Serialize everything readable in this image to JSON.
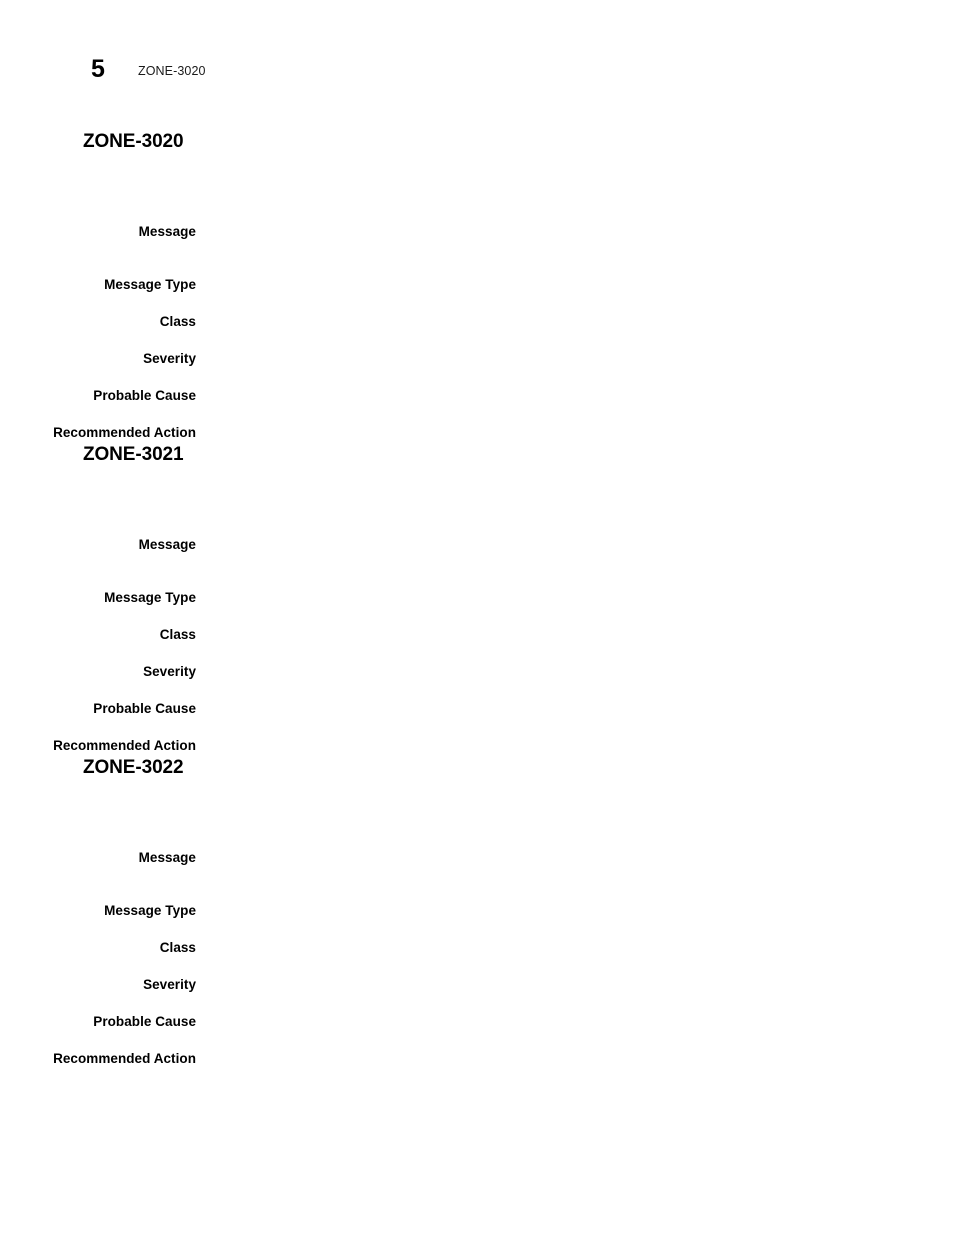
{
  "page": {
    "number": "5",
    "running_head": "ZONE-3020",
    "background_color": "#ffffff",
    "text_color": "#000000"
  },
  "field_labels": {
    "message": "Message",
    "message_type": "Message Type",
    "class": "Class",
    "severity": "Severity",
    "probable_cause": "Probable Cause",
    "recommended_action": "Recommended Action"
  },
  "sections": [
    {
      "heading": "ZONE-3020",
      "fields": [
        {
          "label": "Message",
          "value": ""
        },
        {
          "label": "Message Type",
          "value": ""
        },
        {
          "label": "Class",
          "value": ""
        },
        {
          "label": "Severity",
          "value": ""
        },
        {
          "label": "Probable Cause",
          "value": ""
        },
        {
          "label": "Recommended Action",
          "value": ""
        }
      ]
    },
    {
      "heading": "ZONE-3021",
      "fields": [
        {
          "label": "Message",
          "value": ""
        },
        {
          "label": "Message Type",
          "value": ""
        },
        {
          "label": "Class",
          "value": ""
        },
        {
          "label": "Severity",
          "value": ""
        },
        {
          "label": "Probable Cause",
          "value": ""
        },
        {
          "label": "Recommended Action",
          "value": ""
        }
      ]
    },
    {
      "heading": "ZONE-3022",
      "fields": [
        {
          "label": "Message",
          "value": ""
        },
        {
          "label": "Message Type",
          "value": ""
        },
        {
          "label": "Class",
          "value": ""
        },
        {
          "label": "Severity",
          "value": ""
        },
        {
          "label": "Probable Cause",
          "value": ""
        },
        {
          "label": "Recommended Action",
          "value": ""
        }
      ]
    }
  ],
  "layout": {
    "section_tops": [
      130,
      443,
      756
    ],
    "row_tops": [
      50,
      103,
      140,
      177,
      214,
      251
    ]
  }
}
